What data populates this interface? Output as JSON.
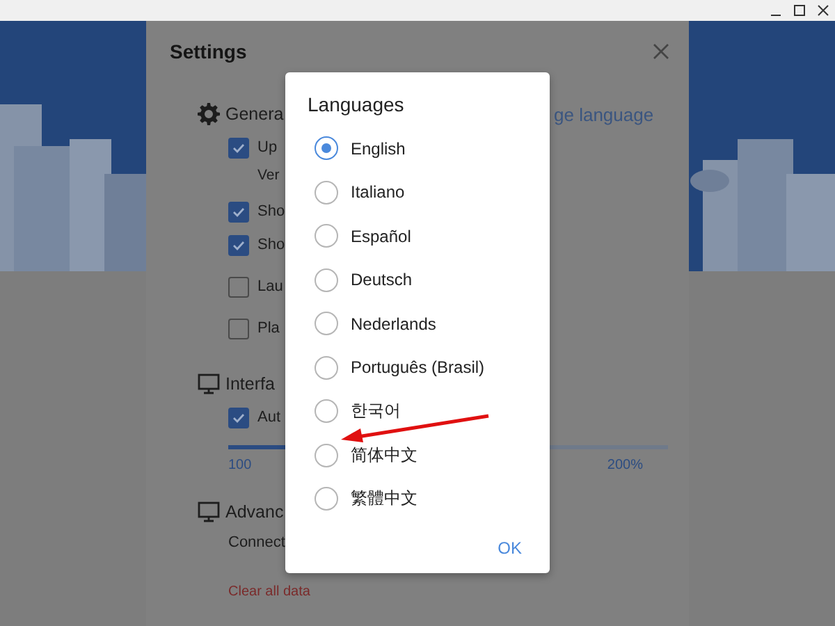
{
  "settings": {
    "title": "Settings",
    "sections": [
      {
        "kind": "gear",
        "title": "Genera",
        "link": "ge language",
        "groups": [
          [
            {
              "kind": "checkbox",
              "label": "Up",
              "checked": true
            },
            {
              "kind": "note",
              "text": "Ver"
            }
          ],
          [
            {
              "kind": "checkbox",
              "label": "Sho",
              "checked": true
            },
            {
              "kind": "checkbox",
              "label": "Sho",
              "checked": true
            }
          ],
          [
            {
              "kind": "checkbox",
              "label": "Lau",
              "checked": false
            }
          ],
          [
            {
              "kind": "checkbox",
              "label": "Pla",
              "checked": false
            }
          ]
        ]
      },
      {
        "kind": "monitor",
        "title": "Interfa",
        "groups": [
          [
            {
              "kind": "checkbox",
              "label": "Aut",
              "checked": true
            },
            {
              "kind": "slider",
              "level": 0.3,
              "min_label": "100",
              "max_label": "200%"
            }
          ]
        ]
      },
      {
        "kind": "monitor",
        "title": "Advanc",
        "groups": [
          [
            {
              "kind": "text",
              "text": "Connect"
            }
          ]
        ]
      }
    ],
    "clear_link": "Clear all data"
  },
  "dialog": {
    "title": "Languages",
    "options": [
      {
        "label": "English",
        "selected": true
      },
      {
        "label": "Italiano",
        "selected": false
      },
      {
        "label": "Español",
        "selected": false
      },
      {
        "label": "Deutsch",
        "selected": false
      },
      {
        "label": "Nederlands",
        "selected": false
      },
      {
        "label": "Português (Brasil)",
        "selected": false
      },
      {
        "label": "한국어",
        "selected": false
      },
      {
        "label": "简体中文",
        "selected": false
      },
      {
        "label": "繁體中文",
        "selected": false
      }
    ],
    "ok": "OK"
  }
}
